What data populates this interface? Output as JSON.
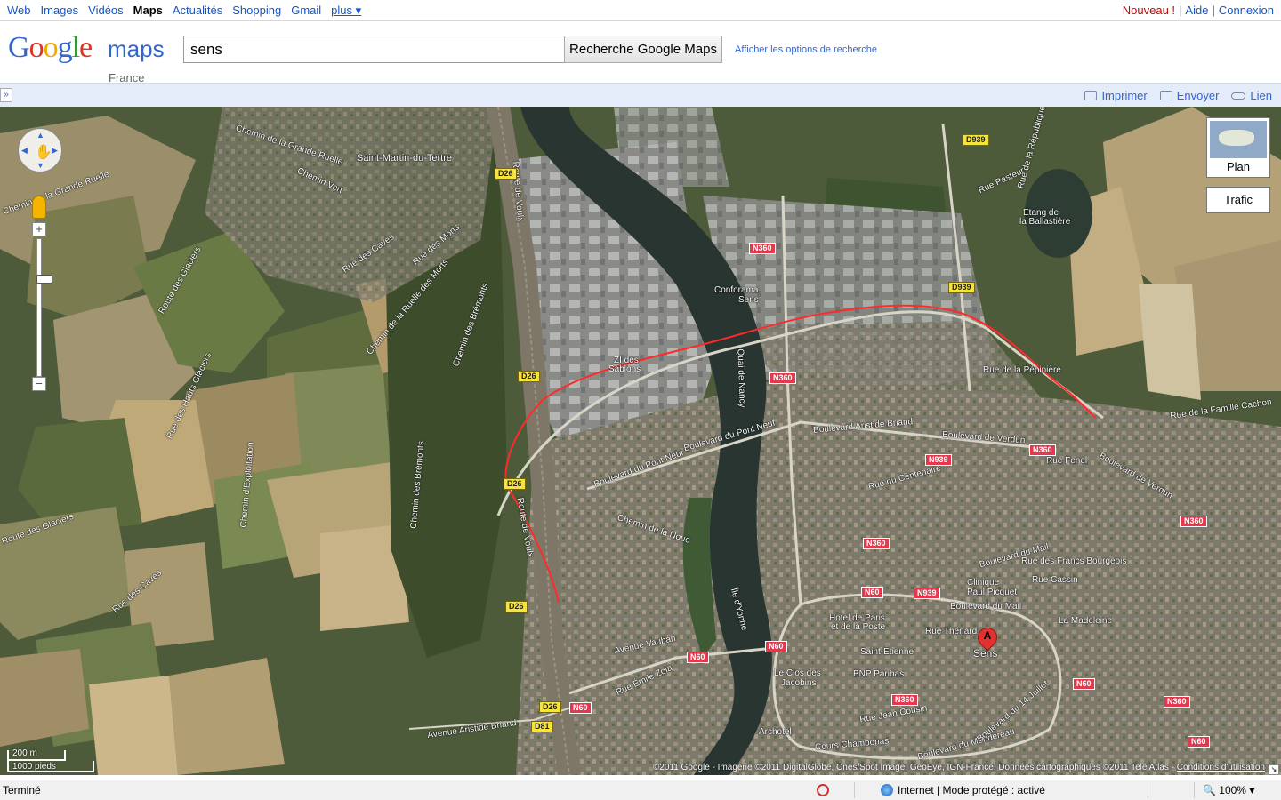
{
  "topnav": {
    "links": [
      "Web",
      "Images",
      "Vidéos",
      "Maps",
      "Actualités",
      "Shopping",
      "Gmail"
    ],
    "more": "plus ▾",
    "new": "Nouveau !",
    "help": "Aide",
    "login": "Connexion",
    "sep": "|"
  },
  "header": {
    "logo_google": [
      "G",
      "o",
      "o",
      "g",
      "l",
      "e"
    ],
    "logo_maps": "maps",
    "logo_country": "France",
    "search_value": "sens",
    "search_button": "Recherche Google Maps",
    "search_options": "Afficher les options de recherche"
  },
  "toolbar": {
    "collapse": "»",
    "print": "Imprimer",
    "send": "Envoyer",
    "link": "Lien"
  },
  "map": {
    "type_button": "Plan",
    "traffic_button": "Trafic",
    "marker_letter": "A",
    "scale_metric": "200 m",
    "scale_imperial": "1000 pieds",
    "copyright": "©2011 Google - Imagerie ©2011 DigitalGlobe, Cnes/Spot Image, GeoEye, IGN-France, Données cartographiques ©2011 Tele Atlas - ",
    "terms": "Conditions d'utilisation",
    "place_labels": {
      "saint_martin": "Saint-Martin-du-Tertre",
      "sens": "Sens",
      "conforama": "Conforama",
      "conforama2": "Sens",
      "zi_sablons": "ZI des",
      "zi_sablons2": "Sablons",
      "etang": "Etang de",
      "etang2": "la Ballastière",
      "clinique": "Clinique",
      "clinique2": "Paul Picquet",
      "hotel": "Hotel de Paris",
      "hotel2": "et de la Poste",
      "saint_etienne": "Saint-Étienne",
      "bnp": "BNP Paribas",
      "clos": "Le Clos des",
      "clos2": "Jacobins",
      "archotel": "Archotel",
      "madeleine": "La Madeleine"
    },
    "street_labels": {
      "grande_ruelle": "Chemin de la Grande Ruelle",
      "chemin_vert": "Chemin Vert",
      "rue_des_caves": "Rue des Caves",
      "rue_des_morts": "Rue des Morts",
      "ruelle_des_morts": "Chemin de la Ruelle des Morts",
      "glaciers": "Route des Glaciers",
      "hauts_glaciers": "Rue des Hauts Glaciers",
      "bremonts": "Chemin des Brémonts",
      "exploitation": "Chemin d'Exploitation",
      "bd_pont_neuf": "Boulevard du Pont Neuf",
      "bd_aristide": "Boulevard Aristide Briand",
      "bd_verdun": "Boulevard de Verdun",
      "bd_mail": "Boulevard du Mail",
      "rue_pepiniere": "Rue de la Pépinière",
      "rue_fenel": "Rue Fenel",
      "francs_bourgeois": "Rue des Francs Bourgeois",
      "rue_cassin": "Rue Cassin",
      "av_vauban": "Avenue Vauban",
      "rue_zola": "Rue Émile Zola",
      "av_aristide": "Avenue Aristide Briand",
      "rue_thenard": "Rue Thénard",
      "rue_jean_cousin": "Rue Jean Cousin",
      "cours_chambonas": "Cours Chambonas",
      "bd_mondereau": "Boulevard du Mondereau",
      "bd_14_juillet": "Boulevard du 14 Juillet",
      "route_de_voulx": "Route de Voulx",
      "famille_cachon": "Rue de la Famille Cachon",
      "quai_nancy": "Quai de Nancy",
      "rue_centenaire": "Rue du Centenaire",
      "rue_republique": "Rue de la République",
      "ile_yonne": "Île d'Yonne",
      "chemin_noue": "Chemin de la Noue",
      "rue_pasteur": "Rue Pasteur"
    },
    "route_shields": {
      "d26_a": "D26",
      "d26_b": "D26",
      "d26_c": "D26",
      "d26_d": "D26",
      "d26_e": "D26",
      "d939_a": "D939",
      "d939_b": "D939",
      "d81": "D81",
      "n360_a": "N360",
      "n360_b": "N360",
      "n360_c": "N360",
      "n360_d": "N360",
      "n360_e": "N360",
      "n360_f": "N360",
      "n360_g": "N360",
      "n939_a": "N939",
      "n939_b": "N939",
      "n60_a": "N60",
      "n60_b": "N60",
      "n60_c": "N60",
      "n60_d": "N60",
      "n60_e": "N60",
      "n60_f": "N60"
    }
  },
  "statusbar": {
    "status": "Terminé",
    "zone": "Internet | Mode protégé : activé",
    "zoom": "100%"
  }
}
